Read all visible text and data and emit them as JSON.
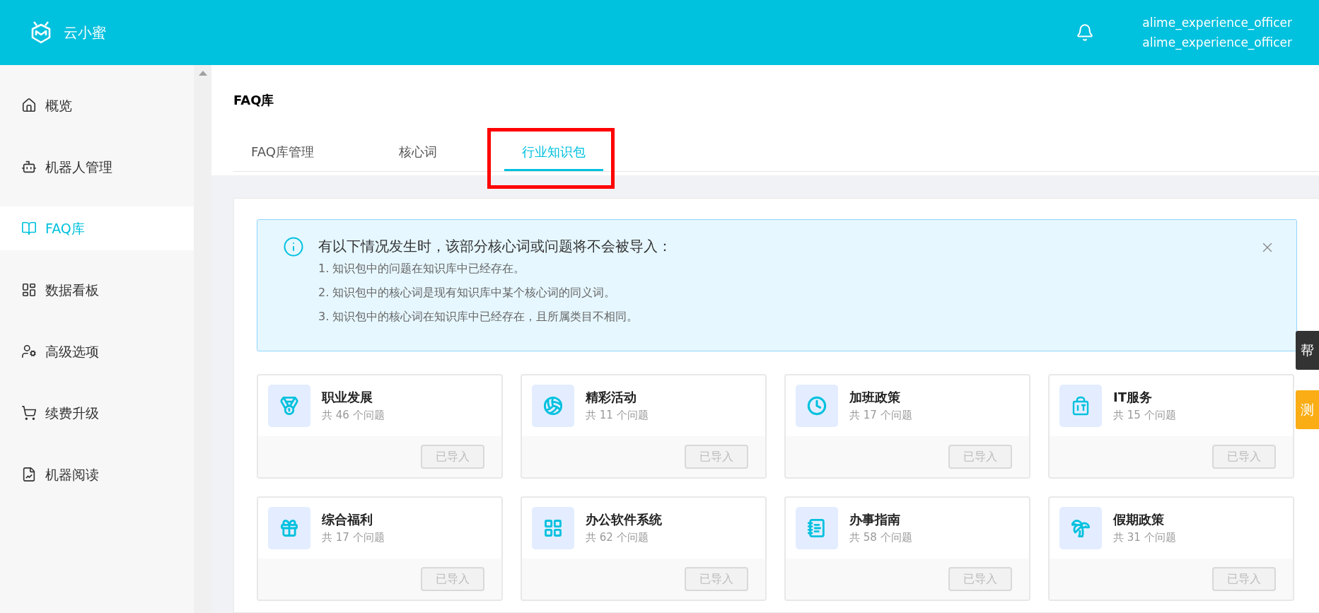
{
  "header": {
    "brand": "云小蜜",
    "user_lines": [
      "alime_experience_officer",
      "alime_experience_officer"
    ]
  },
  "sidebar": {
    "items": [
      {
        "label": "概览",
        "selected": false
      },
      {
        "label": "机器人管理",
        "selected": false
      },
      {
        "label": "FAQ库",
        "selected": true
      },
      {
        "label": "数据看板",
        "selected": false
      },
      {
        "label": "高级选项",
        "selected": false
      },
      {
        "label": "续费升级",
        "selected": false
      },
      {
        "label": "机器阅读",
        "selected": false
      }
    ]
  },
  "page_title": "FAQ库",
  "tabs": [
    {
      "label": "FAQ库管理",
      "selected": false,
      "highlighted": false
    },
    {
      "label": "核心词",
      "selected": false,
      "highlighted": false
    },
    {
      "label": "行业知识包",
      "selected": true,
      "highlighted": true
    }
  ],
  "notice": {
    "title": "有以下情况发生时，该部分核心词或问题将不会被导入：",
    "lines": [
      "1. 知识包中的问题在知识库中已经存在。",
      "2. 知识包中的核心词是现有知识库中某个核心词的同义词。",
      "3. 知识包中的核心词在知识库中已经存在，且所属类目不相同。"
    ]
  },
  "packages": [
    {
      "name": "职业发展",
      "count": "共 46 个问题",
      "button": "已导入",
      "disabled": true
    },
    {
      "name": "精彩活动",
      "count": "共 11 个问题",
      "button": "已导入",
      "disabled": true
    },
    {
      "name": "加班政策",
      "count": "共 17 个问题",
      "button": "已导入",
      "disabled": true
    },
    {
      "name": "IT服务",
      "count": "共 15 个问题",
      "button": "已导入",
      "disabled": true
    },
    {
      "name": "综合福利",
      "count": "共 17 个问题",
      "button": "已导入",
      "disabled": true
    },
    {
      "name": "办公软件系统",
      "count": "共 62 个问题",
      "button": "已导入",
      "disabled": true
    },
    {
      "name": "办事指南",
      "count": "共 58 个问题",
      "button": "已导入",
      "disabled": true
    },
    {
      "name": "假期政策",
      "count": "共 31 个问题",
      "button": "已导入",
      "disabled": true
    }
  ],
  "side_tabs": [
    {
      "label": "帮",
      "color": "#333333"
    },
    {
      "label": "测",
      "color": "#faad14"
    }
  ]
}
